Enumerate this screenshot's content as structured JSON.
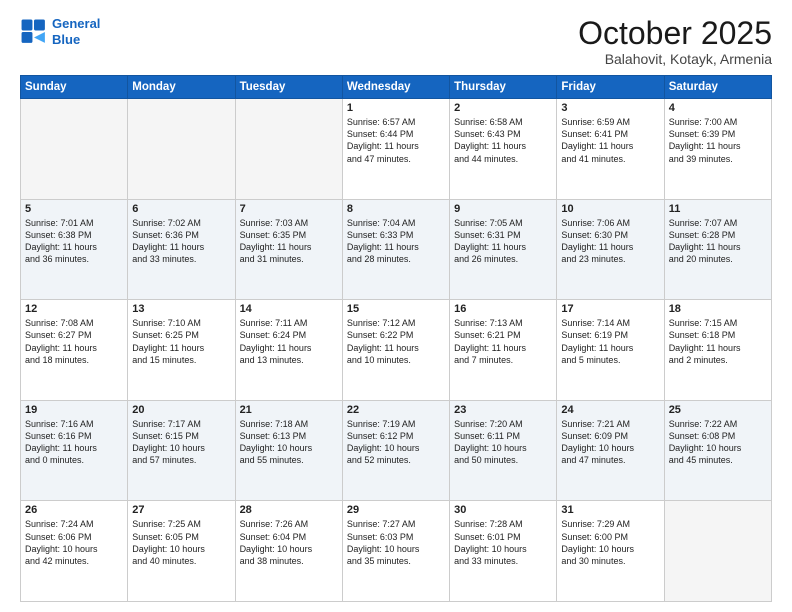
{
  "header": {
    "logo_line1": "General",
    "logo_line2": "Blue",
    "month": "October 2025",
    "location": "Balahovit, Kotayk, Armenia"
  },
  "weekdays": [
    "Sunday",
    "Monday",
    "Tuesday",
    "Wednesday",
    "Thursday",
    "Friday",
    "Saturday"
  ],
  "rows": [
    [
      {
        "day": "",
        "info": ""
      },
      {
        "day": "",
        "info": ""
      },
      {
        "day": "",
        "info": ""
      },
      {
        "day": "1",
        "info": "Sunrise: 6:57 AM\nSunset: 6:44 PM\nDaylight: 11 hours\nand 47 minutes."
      },
      {
        "day": "2",
        "info": "Sunrise: 6:58 AM\nSunset: 6:43 PM\nDaylight: 11 hours\nand 44 minutes."
      },
      {
        "day": "3",
        "info": "Sunrise: 6:59 AM\nSunset: 6:41 PM\nDaylight: 11 hours\nand 41 minutes."
      },
      {
        "day": "4",
        "info": "Sunrise: 7:00 AM\nSunset: 6:39 PM\nDaylight: 11 hours\nand 39 minutes."
      }
    ],
    [
      {
        "day": "5",
        "info": "Sunrise: 7:01 AM\nSunset: 6:38 PM\nDaylight: 11 hours\nand 36 minutes."
      },
      {
        "day": "6",
        "info": "Sunrise: 7:02 AM\nSunset: 6:36 PM\nDaylight: 11 hours\nand 33 minutes."
      },
      {
        "day": "7",
        "info": "Sunrise: 7:03 AM\nSunset: 6:35 PM\nDaylight: 11 hours\nand 31 minutes."
      },
      {
        "day": "8",
        "info": "Sunrise: 7:04 AM\nSunset: 6:33 PM\nDaylight: 11 hours\nand 28 minutes."
      },
      {
        "day": "9",
        "info": "Sunrise: 7:05 AM\nSunset: 6:31 PM\nDaylight: 11 hours\nand 26 minutes."
      },
      {
        "day": "10",
        "info": "Sunrise: 7:06 AM\nSunset: 6:30 PM\nDaylight: 11 hours\nand 23 minutes."
      },
      {
        "day": "11",
        "info": "Sunrise: 7:07 AM\nSunset: 6:28 PM\nDaylight: 11 hours\nand 20 minutes."
      }
    ],
    [
      {
        "day": "12",
        "info": "Sunrise: 7:08 AM\nSunset: 6:27 PM\nDaylight: 11 hours\nand 18 minutes."
      },
      {
        "day": "13",
        "info": "Sunrise: 7:10 AM\nSunset: 6:25 PM\nDaylight: 11 hours\nand 15 minutes."
      },
      {
        "day": "14",
        "info": "Sunrise: 7:11 AM\nSunset: 6:24 PM\nDaylight: 11 hours\nand 13 minutes."
      },
      {
        "day": "15",
        "info": "Sunrise: 7:12 AM\nSunset: 6:22 PM\nDaylight: 11 hours\nand 10 minutes."
      },
      {
        "day": "16",
        "info": "Sunrise: 7:13 AM\nSunset: 6:21 PM\nDaylight: 11 hours\nand 7 minutes."
      },
      {
        "day": "17",
        "info": "Sunrise: 7:14 AM\nSunset: 6:19 PM\nDaylight: 11 hours\nand 5 minutes."
      },
      {
        "day": "18",
        "info": "Sunrise: 7:15 AM\nSunset: 6:18 PM\nDaylight: 11 hours\nand 2 minutes."
      }
    ],
    [
      {
        "day": "19",
        "info": "Sunrise: 7:16 AM\nSunset: 6:16 PM\nDaylight: 11 hours\nand 0 minutes."
      },
      {
        "day": "20",
        "info": "Sunrise: 7:17 AM\nSunset: 6:15 PM\nDaylight: 10 hours\nand 57 minutes."
      },
      {
        "day": "21",
        "info": "Sunrise: 7:18 AM\nSunset: 6:13 PM\nDaylight: 10 hours\nand 55 minutes."
      },
      {
        "day": "22",
        "info": "Sunrise: 7:19 AM\nSunset: 6:12 PM\nDaylight: 10 hours\nand 52 minutes."
      },
      {
        "day": "23",
        "info": "Sunrise: 7:20 AM\nSunset: 6:11 PM\nDaylight: 10 hours\nand 50 minutes."
      },
      {
        "day": "24",
        "info": "Sunrise: 7:21 AM\nSunset: 6:09 PM\nDaylight: 10 hours\nand 47 minutes."
      },
      {
        "day": "25",
        "info": "Sunrise: 7:22 AM\nSunset: 6:08 PM\nDaylight: 10 hours\nand 45 minutes."
      }
    ],
    [
      {
        "day": "26",
        "info": "Sunrise: 7:24 AM\nSunset: 6:06 PM\nDaylight: 10 hours\nand 42 minutes."
      },
      {
        "day": "27",
        "info": "Sunrise: 7:25 AM\nSunset: 6:05 PM\nDaylight: 10 hours\nand 40 minutes."
      },
      {
        "day": "28",
        "info": "Sunrise: 7:26 AM\nSunset: 6:04 PM\nDaylight: 10 hours\nand 38 minutes."
      },
      {
        "day": "29",
        "info": "Sunrise: 7:27 AM\nSunset: 6:03 PM\nDaylight: 10 hours\nand 35 minutes."
      },
      {
        "day": "30",
        "info": "Sunrise: 7:28 AM\nSunset: 6:01 PM\nDaylight: 10 hours\nand 33 minutes."
      },
      {
        "day": "31",
        "info": "Sunrise: 7:29 AM\nSunset: 6:00 PM\nDaylight: 10 hours\nand 30 minutes."
      },
      {
        "day": "",
        "info": ""
      }
    ]
  ]
}
